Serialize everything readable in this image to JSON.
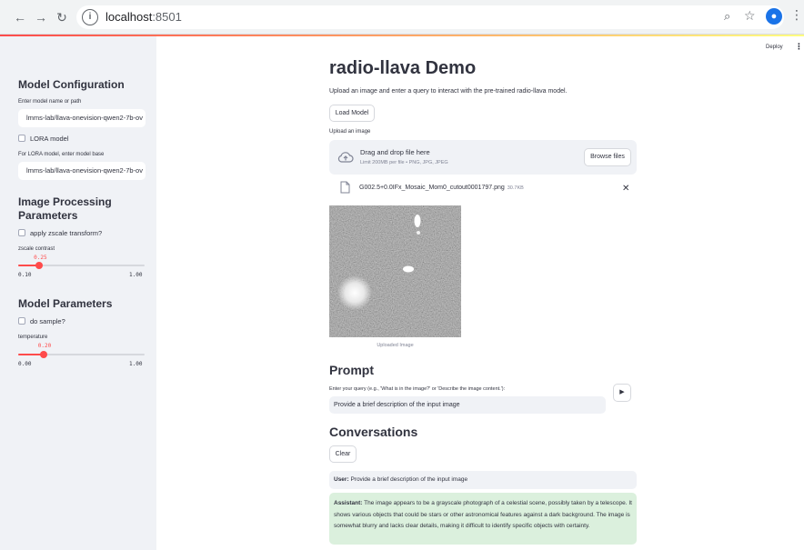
{
  "browser": {
    "url_host": "localhost",
    "url_port": ":8501"
  },
  "sidebar": {
    "model_config": {
      "heading": "Model Configuration",
      "model_label": "Enter model name or path",
      "model_value": "lmms-lab/llava-onevision-qwen2-7b-ov",
      "lora_label": "LORA model",
      "base_label": "For LORA model, enter model base",
      "base_value": "lmms-lab/llava-onevision-qwen2-7b-ov"
    },
    "image_processing": {
      "heading_line1": "Image Processing",
      "heading_line2": "Parameters",
      "zscale_label": "apply zscale transform?",
      "contrast_label": "zscale contrast",
      "contrast_value": "0.25",
      "contrast_min": "0.10",
      "contrast_max": "1.00",
      "contrast_fraction": 0.1667
    },
    "model_params": {
      "heading": "Model Parameters",
      "sample_label": "do sample?",
      "temp_label": "temperature",
      "temp_value": "0.20",
      "temp_min": "0.00",
      "temp_max": "1.00",
      "temp_fraction": 0.2
    }
  },
  "header": {
    "deploy": "Deploy",
    "menu": "⋮"
  },
  "main": {
    "title": "radio-llava Demo",
    "subtitle": "Upload an image and enter a query to interact with the pre-trained radio-llava model.",
    "load_button": "Load Model",
    "upload_label": "Upload an image",
    "dropzone_text": "Drag and drop file here",
    "dropzone_limit": "Limit 200MB per file • PNG, JPG, JPEG",
    "browse_button": "Browse files",
    "file_name": "G002.5+0.0IFx_Mosaic_Mom0_cutout0001797.png",
    "file_size": "30.7KB",
    "image_caption": "Uploaded Image",
    "prompt_heading": "Prompt",
    "prompt_label": "Enter your query (e.g., 'What is in the image?' or 'Describe the image content.'):",
    "prompt_value": "Provide a brief description of the input image",
    "send_icon": "▶",
    "conv_heading": "Conversations",
    "clear_button": "Clear",
    "user_label": "User:",
    "user_message": "Provide a brief description of the input image",
    "assistant_label": "Assistant:",
    "assistant_message": "The image appears to be a grayscale photograph of a celestial scene, possibly taken by a telescope. It shows various objects that could be stars or other astronomical features against a dark background. The image is somewhat blurry and lacks clear details, making it difficult to identify specific objects with certainty."
  }
}
